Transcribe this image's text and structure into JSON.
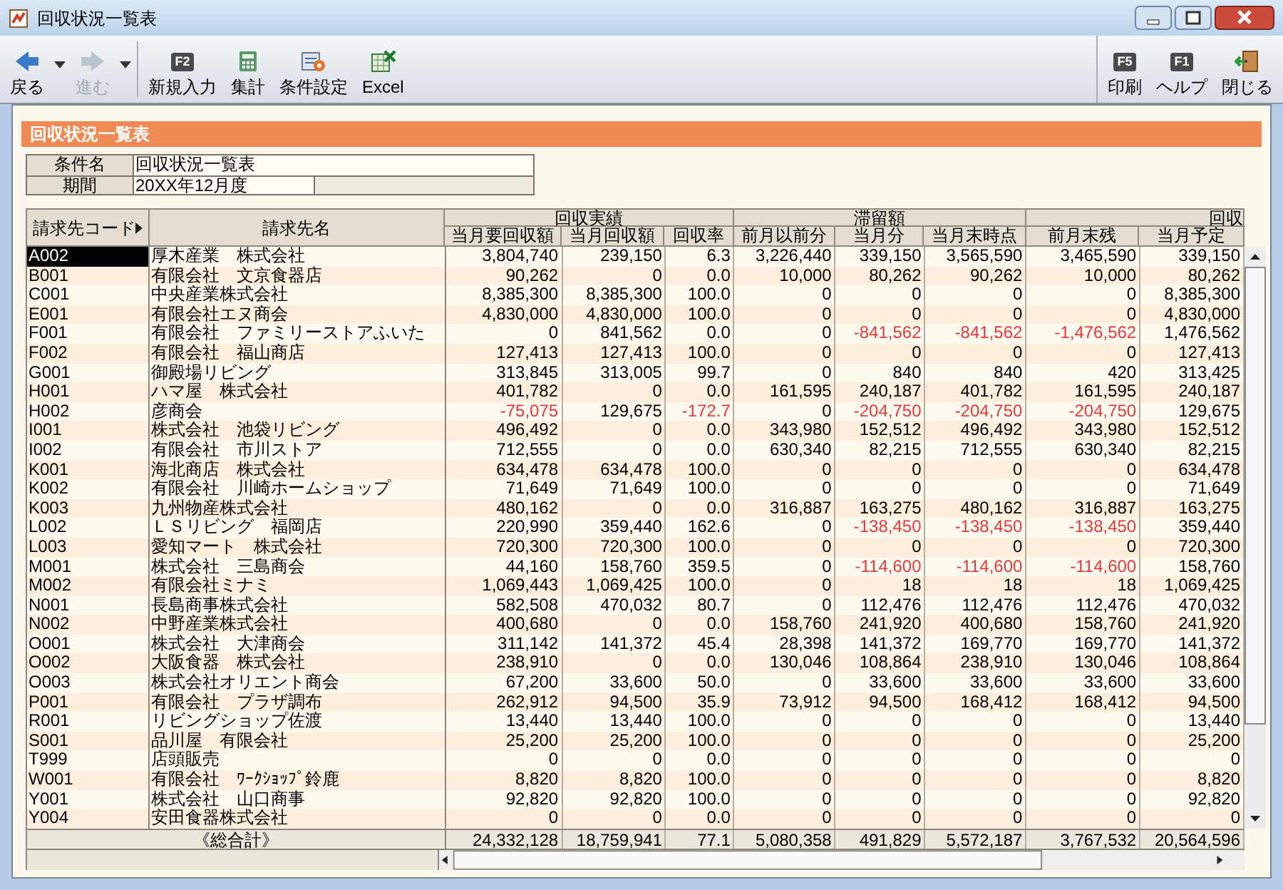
{
  "window": {
    "title": "回収状況一覧表"
  },
  "toolbar": {
    "left": [
      {
        "kind": "back",
        "label": "戻る",
        "disabled": false
      },
      {
        "kind": "forward",
        "label": "進む",
        "disabled": true
      },
      {
        "kind": "key",
        "key": "F2",
        "label": "新規入力",
        "disabled": false
      },
      {
        "kind": "calc",
        "label": "集計",
        "disabled": false
      },
      {
        "kind": "settings",
        "label": "条件設定",
        "disabled": false
      },
      {
        "kind": "excel",
        "label": "Excel",
        "disabled": false
      }
    ],
    "right": [
      {
        "kind": "key",
        "key": "F5",
        "label": "印刷",
        "disabled": false
      },
      {
        "kind": "key",
        "key": "F1",
        "label": "ヘルプ",
        "disabled": false
      },
      {
        "kind": "close",
        "label": "閉じる",
        "disabled": false
      }
    ]
  },
  "section_title": "回収状況一覧表",
  "conditions": [
    {
      "label": "条件名",
      "value": "回収状況一覧表"
    },
    {
      "label": "期間",
      "value": "20XX年12月度"
    }
  ],
  "table": {
    "key_columns": [
      "請求先コード",
      "請求先名"
    ],
    "column_groups": [
      {
        "label": "回収実績",
        "columns": [
          "当月要回収額",
          "当月回収額",
          "回収率"
        ]
      },
      {
        "label": "滞留額",
        "columns": [
          "前月以前分",
          "当月分",
          "当月末時点"
        ]
      },
      {
        "label": "回収",
        "columns": [
          "前月末残",
          "当月予定"
        ]
      }
    ],
    "rows": [
      {
        "code": "A002",
        "name": "厚木産業　株式会社",
        "selected": true,
        "values": [
          "3,804,740",
          "239,150",
          "6.3",
          "3,226,440",
          "339,150",
          "3,565,590",
          "3,465,590",
          "339,150"
        ]
      },
      {
        "code": "B001",
        "name": "有限会社　文京食器店",
        "selected": false,
        "values": [
          "90,262",
          "0",
          "0.0",
          "10,000",
          "80,262",
          "90,262",
          "10,000",
          "80,262"
        ]
      },
      {
        "code": "C001",
        "name": "中央産業株式会社",
        "selected": false,
        "values": [
          "8,385,300",
          "8,385,300",
          "100.0",
          "0",
          "0",
          "0",
          "0",
          "8,385,300"
        ]
      },
      {
        "code": "E001",
        "name": "有限会社エヌ商会",
        "selected": false,
        "values": [
          "4,830,000",
          "4,830,000",
          "100.0",
          "0",
          "0",
          "0",
          "0",
          "4,830,000"
        ]
      },
      {
        "code": "F001",
        "name": "有限会社　ファミリーストアふいた",
        "selected": false,
        "values": [
          "0",
          "841,562",
          "0.0",
          "0",
          "-841,562",
          "-841,562",
          "-1,476,562",
          "1,476,562"
        ]
      },
      {
        "code": "F002",
        "name": "有限会社　福山商店",
        "selected": false,
        "values": [
          "127,413",
          "127,413",
          "100.0",
          "0",
          "0",
          "0",
          "0",
          "127,413"
        ]
      },
      {
        "code": "G001",
        "name": "御殿場リビング",
        "selected": false,
        "values": [
          "313,845",
          "313,005",
          "99.7",
          "0",
          "840",
          "840",
          "420",
          "313,425"
        ]
      },
      {
        "code": "H001",
        "name": "ハマ屋　株式会社",
        "selected": false,
        "values": [
          "401,782",
          "0",
          "0.0",
          "161,595",
          "240,187",
          "401,782",
          "161,595",
          "240,187"
        ]
      },
      {
        "code": "H002",
        "name": "彦商会",
        "selected": false,
        "values": [
          "-75,075",
          "129,675",
          "-172.7",
          "0",
          "-204,750",
          "-204,750",
          "-204,750",
          "129,675"
        ]
      },
      {
        "code": "I001",
        "name": "株式会社　池袋リビング",
        "selected": false,
        "values": [
          "496,492",
          "0",
          "0.0",
          "343,980",
          "152,512",
          "496,492",
          "343,980",
          "152,512"
        ]
      },
      {
        "code": "I002",
        "name": "有限会社　市川ストア",
        "selected": false,
        "values": [
          "712,555",
          "0",
          "0.0",
          "630,340",
          "82,215",
          "712,555",
          "630,340",
          "82,215"
        ]
      },
      {
        "code": "K001",
        "name": "海北商店　株式会社",
        "selected": false,
        "values": [
          "634,478",
          "634,478",
          "100.0",
          "0",
          "0",
          "0",
          "0",
          "634,478"
        ]
      },
      {
        "code": "K002",
        "name": "有限会社　川崎ホームショップ",
        "selected": false,
        "values": [
          "71,649",
          "71,649",
          "100.0",
          "0",
          "0",
          "0",
          "0",
          "71,649"
        ]
      },
      {
        "code": "K003",
        "name": "九州物産株式会社",
        "selected": false,
        "values": [
          "480,162",
          "0",
          "0.0",
          "316,887",
          "163,275",
          "480,162",
          "316,887",
          "163,275"
        ]
      },
      {
        "code": "L002",
        "name": "ＬＳリビング　福岡店",
        "selected": false,
        "values": [
          "220,990",
          "359,440",
          "162.6",
          "0",
          "-138,450",
          "-138,450",
          "-138,450",
          "359,440"
        ]
      },
      {
        "code": "L003",
        "name": "愛知マート　株式会社",
        "selected": false,
        "values": [
          "720,300",
          "720,300",
          "100.0",
          "0",
          "0",
          "0",
          "0",
          "720,300"
        ]
      },
      {
        "code": "M001",
        "name": "株式会社　三島商会",
        "selected": false,
        "values": [
          "44,160",
          "158,760",
          "359.5",
          "0",
          "-114,600",
          "-114,600",
          "-114,600",
          "158,760"
        ]
      },
      {
        "code": "M002",
        "name": "有限会社ミナミ",
        "selected": false,
        "values": [
          "1,069,443",
          "1,069,425",
          "100.0",
          "0",
          "18",
          "18",
          "18",
          "1,069,425"
        ]
      },
      {
        "code": "N001",
        "name": "長島商事株式会社",
        "selected": false,
        "values": [
          "582,508",
          "470,032",
          "80.7",
          "0",
          "112,476",
          "112,476",
          "112,476",
          "470,032"
        ]
      },
      {
        "code": "N002",
        "name": "中野産業株式会社",
        "selected": false,
        "values": [
          "400,680",
          "0",
          "0.0",
          "158,760",
          "241,920",
          "400,680",
          "158,760",
          "241,920"
        ]
      },
      {
        "code": "O001",
        "name": "株式会社　大津商会",
        "selected": false,
        "values": [
          "311,142",
          "141,372",
          "45.4",
          "28,398",
          "141,372",
          "169,770",
          "169,770",
          "141,372"
        ]
      },
      {
        "code": "O002",
        "name": "大阪食器　株式会社",
        "selected": false,
        "values": [
          "238,910",
          "0",
          "0.0",
          "130,046",
          "108,864",
          "238,910",
          "130,046",
          "108,864"
        ]
      },
      {
        "code": "O003",
        "name": "株式会社オリエント商会",
        "selected": false,
        "values": [
          "67,200",
          "33,600",
          "50.0",
          "0",
          "33,600",
          "33,600",
          "33,600",
          "33,600"
        ]
      },
      {
        "code": "P001",
        "name": "有限会社　プラザ調布",
        "selected": false,
        "values": [
          "262,912",
          "94,500",
          "35.9",
          "73,912",
          "94,500",
          "168,412",
          "168,412",
          "94,500"
        ]
      },
      {
        "code": "R001",
        "name": "リビングショップ佐渡",
        "selected": false,
        "values": [
          "13,440",
          "13,440",
          "100.0",
          "0",
          "0",
          "0",
          "0",
          "13,440"
        ]
      },
      {
        "code": "S001",
        "name": "品川屋　有限会社",
        "selected": false,
        "values": [
          "25,200",
          "25,200",
          "100.0",
          "0",
          "0",
          "0",
          "0",
          "25,200"
        ]
      },
      {
        "code": "T999",
        "name": "店頭販売",
        "selected": false,
        "values": [
          "0",
          "0",
          "0.0",
          "0",
          "0",
          "0",
          "0",
          "0"
        ]
      },
      {
        "code": "W001",
        "name": "有限会社　ﾜｰｸｼｮｯﾌﾟ鈴鹿",
        "selected": false,
        "values": [
          "8,820",
          "8,820",
          "100.0",
          "0",
          "0",
          "0",
          "0",
          "8,820"
        ]
      },
      {
        "code": "Y001",
        "name": "株式会社　山口商事",
        "selected": false,
        "values": [
          "92,820",
          "92,820",
          "100.0",
          "0",
          "0",
          "0",
          "0",
          "92,820"
        ]
      },
      {
        "code": "Y004",
        "name": "安田食器株式会社",
        "selected": false,
        "values": [
          "0",
          "0",
          "0.0",
          "0",
          "0",
          "0",
          "0",
          "0"
        ]
      }
    ],
    "total": {
      "label": "《総合計》",
      "values": [
        "24,332,128",
        "18,759,941",
        "77.1",
        "5,080,358",
        "491,829",
        "5,572,187",
        "3,767,532",
        "20,564,596"
      ]
    }
  }
}
